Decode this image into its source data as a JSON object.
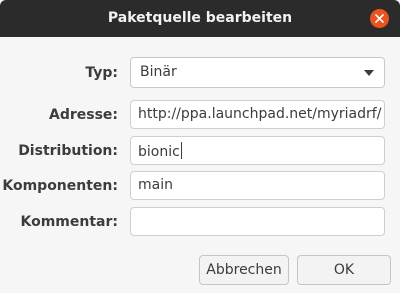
{
  "window": {
    "title": "Paketquelle bearbeiten",
    "close_icon": "close-icon"
  },
  "form": {
    "type_label": "Typ:",
    "type_value": "Binär",
    "address_label": "Adresse:",
    "address_value": "http://ppa.launchpad.net/myriadrf/",
    "distribution_label": "Distribution:",
    "distribution_value": "bionic",
    "components_label": "Komponenten:",
    "components_value": "main",
    "comment_label": "Kommentar:",
    "comment_value": ""
  },
  "buttons": {
    "cancel": "Abbrechen",
    "ok": "OK"
  },
  "colors": {
    "titlebar": "#2b2b2b",
    "close": "#e95420",
    "background": "#f6f6f6"
  }
}
